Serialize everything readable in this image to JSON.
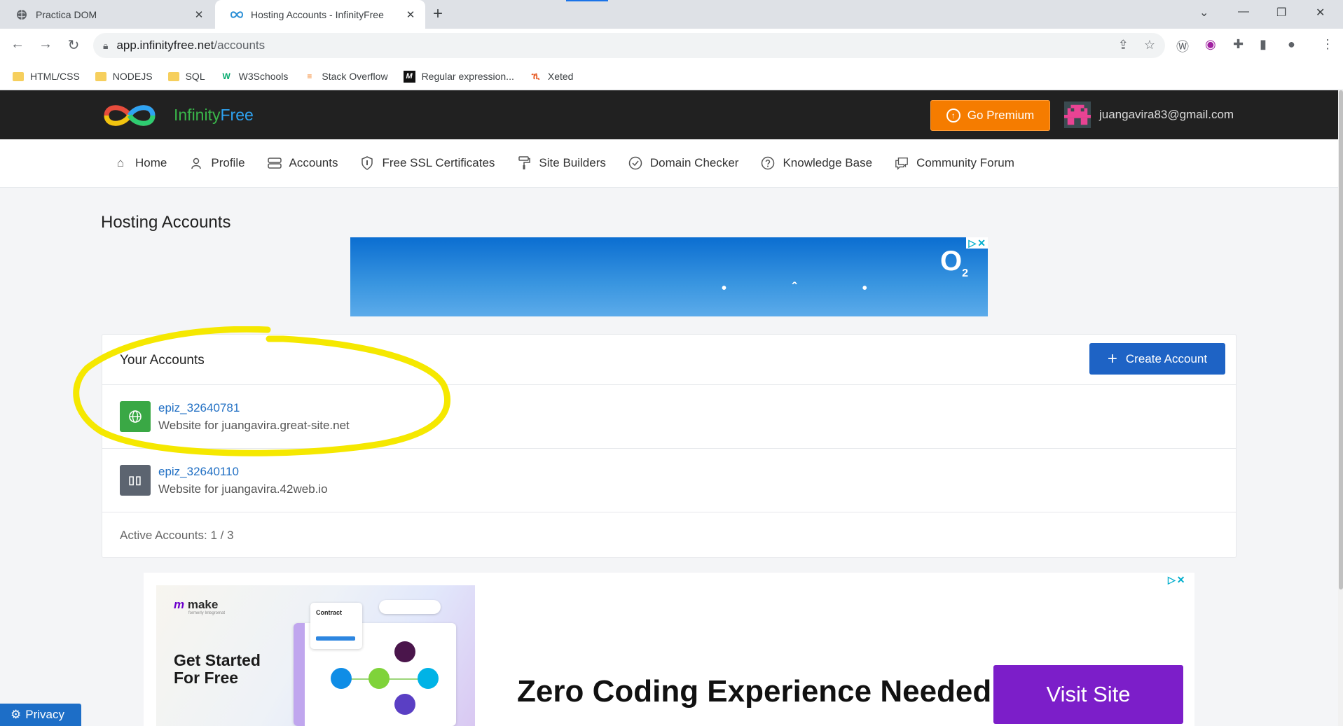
{
  "browser": {
    "tabs": [
      {
        "title": "Practica DOM",
        "active": false
      },
      {
        "title": "Hosting Accounts - InfinityFree",
        "active": true
      }
    ],
    "url_host": "app.infinityfree.net",
    "url_path": "/accounts",
    "bookmarks": [
      {
        "label": "HTML/CSS",
        "icon": "folder-icon"
      },
      {
        "label": "NODEJS",
        "icon": "folder-icon"
      },
      {
        "label": "SQL",
        "icon": "folder-icon"
      },
      {
        "label": "W3Schools",
        "icon": "w3schools-icon"
      },
      {
        "label": "Stack Overflow",
        "icon": "stackoverflow-icon"
      },
      {
        "label": "Regular expression...",
        "icon": "regex-icon"
      },
      {
        "label": "Xeted",
        "icon": "xeted-icon"
      }
    ]
  },
  "header": {
    "brand_part1": "Infinity",
    "brand_part2": "Free",
    "premium_label": "Go Premium",
    "user_email": "juangavira83@gmail.com"
  },
  "nav": [
    {
      "label": "Home",
      "icon": "home-icon"
    },
    {
      "label": "Profile",
      "icon": "user-icon"
    },
    {
      "label": "Accounts",
      "icon": "server-icon"
    },
    {
      "label": "Free SSL Certificates",
      "icon": "shield-icon"
    },
    {
      "label": "Site Builders",
      "icon": "paint-roller-icon"
    },
    {
      "label": "Domain Checker",
      "icon": "check-circle-icon"
    },
    {
      "label": "Knowledge Base",
      "icon": "question-circle-icon"
    },
    {
      "label": "Community Forum",
      "icon": "chat-icon"
    }
  ],
  "page": {
    "title": "Hosting Accounts"
  },
  "accounts_card": {
    "title": "Your Accounts",
    "create_label": "Create Account",
    "accounts": [
      {
        "name": "epiz_32640781",
        "description": "Website for juangavira.great-site.net",
        "status": "active",
        "icon": "globe-icon"
      },
      {
        "name": "epiz_32640110",
        "description": "Website for juangavira.42web.io",
        "status": "suspended",
        "icon": "pause-icon"
      }
    ],
    "footer": "Active Accounts: 1 / 3"
  },
  "ad_banner": {
    "brand": "O",
    "brand_sub": "2"
  },
  "ad_make": {
    "logo": "make",
    "logo_sub": "formerly Integromat",
    "tagline": "Get Started For Free",
    "contract_label": "Contract",
    "headline": "Zero Coding Experience Needed",
    "cta": "Visit Site"
  },
  "privacy_label": "Privacy",
  "colors": {
    "header_bg": "#212121",
    "premium": "#f57c00",
    "primary": "#1e63c5",
    "active_green": "#3aa845",
    "suspended_grey": "#5c6470",
    "highlight": "#f5e800",
    "cta_purple": "#7c1ec9"
  }
}
